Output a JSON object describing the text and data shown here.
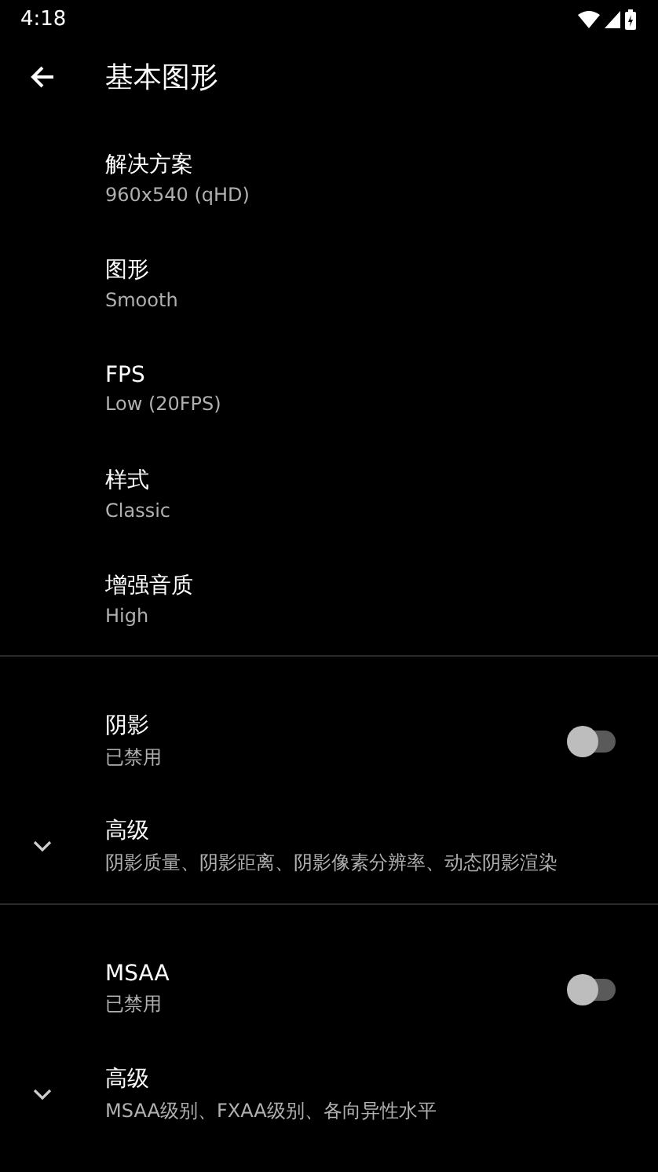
{
  "status_bar": {
    "time": "4:18"
  },
  "toolbar": {
    "title": "基本图形"
  },
  "sections": [
    {
      "items": [
        {
          "kind": "pref",
          "title": "解决方案",
          "summary": "960x540 (qHD)"
        },
        {
          "kind": "pref",
          "title": "图形",
          "summary": "Smooth"
        },
        {
          "kind": "pref",
          "title": "FPS",
          "summary": "Low (20FPS)"
        },
        {
          "kind": "pref",
          "title": "样式",
          "summary": "Classic"
        },
        {
          "kind": "pref",
          "title": "增强音质",
          "summary": "High"
        }
      ]
    },
    {
      "items": [
        {
          "kind": "switch",
          "title": "阴影",
          "summary": "已禁用",
          "on": false
        },
        {
          "kind": "expander",
          "title": "高级",
          "summary": "阴影质量、阴影距离、阴影像素分辨率、动态阴影渲染",
          "expanded": false
        }
      ]
    },
    {
      "items": [
        {
          "kind": "switch",
          "title": "MSAA",
          "summary": "已禁用",
          "on": false
        },
        {
          "kind": "expander",
          "title": "高级",
          "summary": "MSAA级别、FXAA级别、各向异性水平",
          "expanded": false
        }
      ]
    }
  ]
}
